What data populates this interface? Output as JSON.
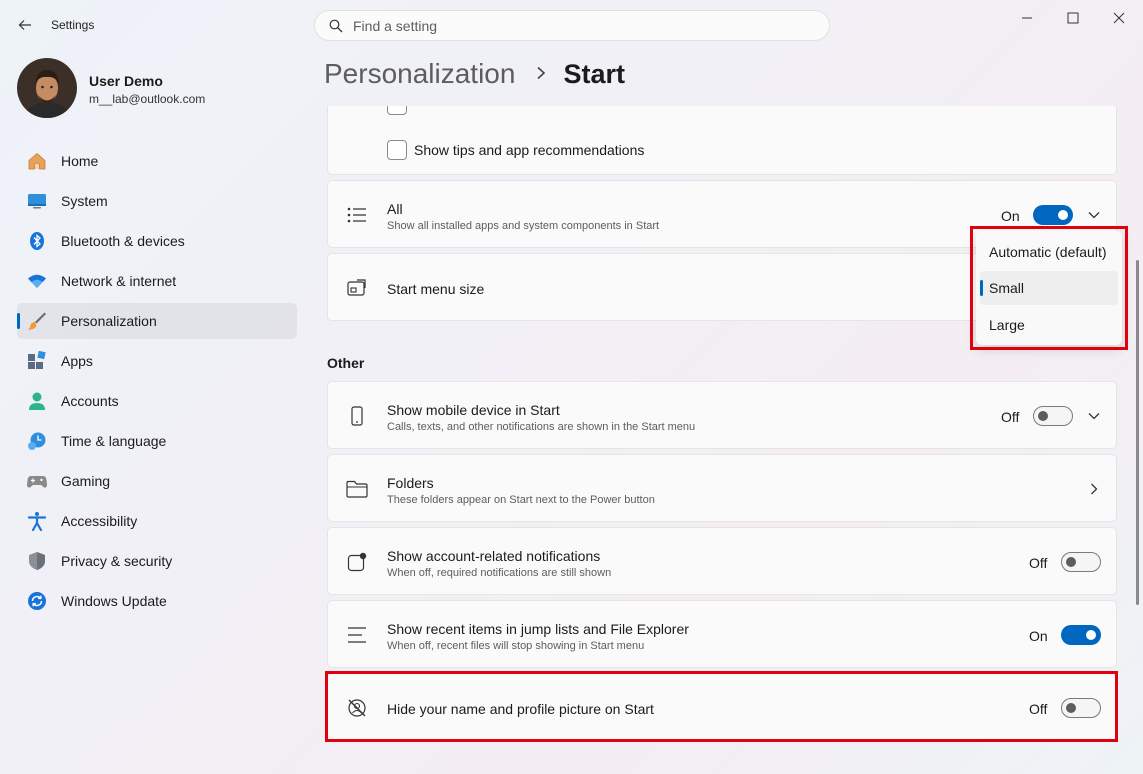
{
  "window": {
    "title": "Settings"
  },
  "search": {
    "placeholder": "Find a setting"
  },
  "user": {
    "name": "User Demo",
    "email": "m__lab@outlook.com"
  },
  "nav": [
    {
      "label": "Home",
      "icon": "home-icon"
    },
    {
      "label": "System",
      "icon": "system-icon"
    },
    {
      "label": "Bluetooth & devices",
      "icon": "bluetooth-icon"
    },
    {
      "label": "Network & internet",
      "icon": "wifi-icon"
    },
    {
      "label": "Personalization",
      "icon": "brush-icon",
      "active": true
    },
    {
      "label": "Apps",
      "icon": "apps-icon"
    },
    {
      "label": "Accounts",
      "icon": "account-icon"
    },
    {
      "label": "Time & language",
      "icon": "clock-globe-icon"
    },
    {
      "label": "Gaming",
      "icon": "gamepad-icon"
    },
    {
      "label": "Accessibility",
      "icon": "accessibility-icon"
    },
    {
      "label": "Privacy & security",
      "icon": "shield-icon"
    },
    {
      "label": "Windows Update",
      "icon": "update-icon"
    }
  ],
  "breadcrumb": {
    "parent": "Personalization",
    "current": "Start"
  },
  "settings": {
    "tips": {
      "label": "Show tips and app recommendations",
      "checked": false
    },
    "all": {
      "title": "All",
      "subtitle": "Show all installed apps and system components in Start",
      "state": "On"
    },
    "menu_size": {
      "title": "Start menu size"
    },
    "other_heading": "Other",
    "mobile": {
      "title": "Show mobile device in Start",
      "subtitle": "Calls, texts, and other notifications are shown in the Start menu",
      "state": "Off"
    },
    "folders": {
      "title": "Folders",
      "subtitle": "These folders appear on Start next to the Power button"
    },
    "account_notif": {
      "title": "Show account-related notifications",
      "subtitle": "When off, required notifications are still shown",
      "state": "Off"
    },
    "recent": {
      "title": "Show recent items in jump lists and File Explorer",
      "subtitle": "When off, recent files will stop showing in Start menu",
      "state": "On"
    },
    "hide_name": {
      "title": "Hide your name and profile picture on Start",
      "state": "Off"
    }
  },
  "dropdown": {
    "options": [
      "Automatic (default)",
      "Small",
      "Large"
    ],
    "selected": "Small"
  },
  "colors": {
    "accent": "#0067c0",
    "highlight": "#e0000e"
  }
}
